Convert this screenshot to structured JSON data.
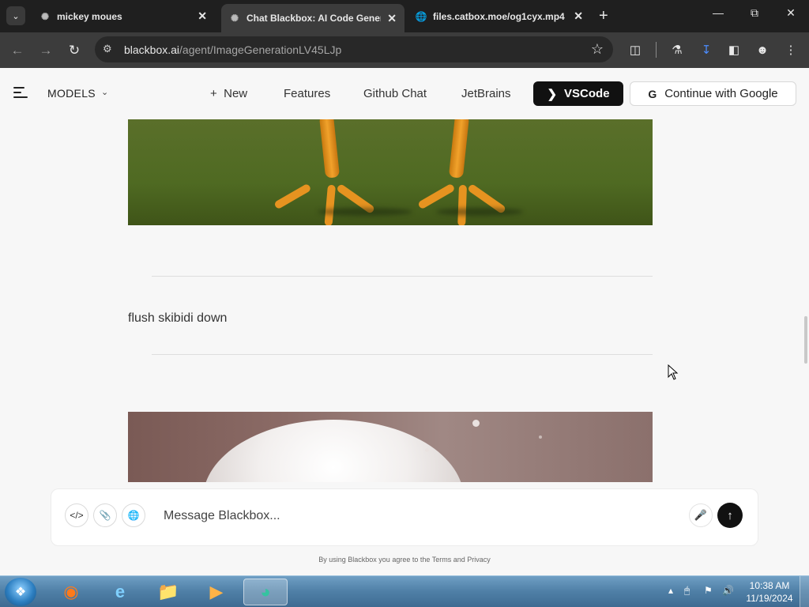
{
  "browser": {
    "tabs": [
      {
        "title": "mickey moues",
        "active": false
      },
      {
        "title": "Chat Blackbox: AI Code Generation",
        "active": true
      },
      {
        "title": "files.catbox.moe/og1cyx.mp4",
        "active": false
      }
    ],
    "url_host": "blackbox.ai",
    "url_path": "/agent/ImageGenerationLV45LJp"
  },
  "header": {
    "models_label": "MODELS",
    "nav": {
      "new": "New",
      "features": "Features",
      "github_chat": "Github Chat",
      "jetbrains": "JetBrains"
    },
    "vscode_label": "VSCode",
    "google_label": "Continue with Google"
  },
  "chat": {
    "user_message": "flush skibidi down"
  },
  "composer": {
    "placeholder": "Message Blackbox...",
    "terms": "By using Blackbox you agree to the Terms and Privacy"
  },
  "taskbar": {
    "time": "10:38 AM",
    "date": "11/19/2024"
  },
  "colors": {
    "accent": "#111111",
    "page_bg": "#f7f7f7",
    "chrome_dark": "#1f1f1f"
  }
}
